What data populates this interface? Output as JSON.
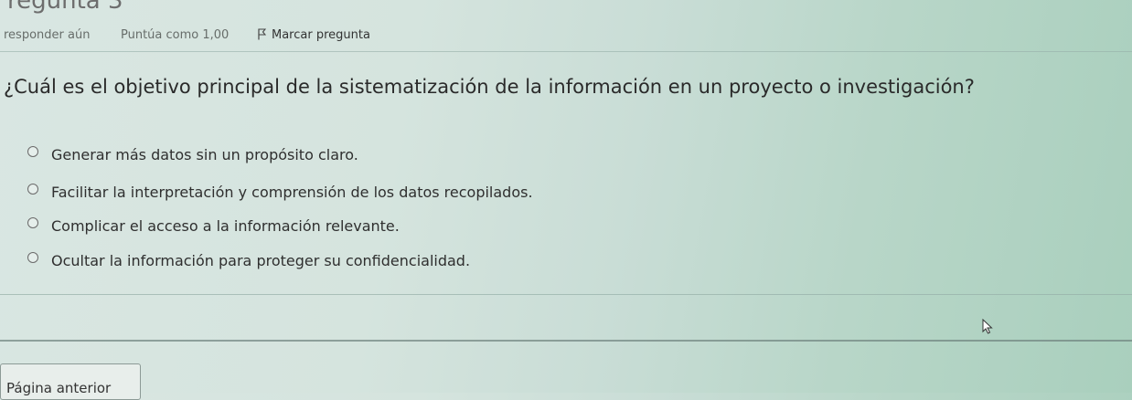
{
  "header": {
    "title_partial": "regunta 3",
    "status_text": "responder aún",
    "score_text": "Puntúa como 1,00",
    "flag_label": "Marcar pregunta"
  },
  "question": {
    "text": "¿Cuál es el objetivo principal de la sistematización de la información en un proyecto o investigación?",
    "options": [
      {
        "label": "Generar más datos sin un propósito claro."
      },
      {
        "label": "Facilitar la interpretación y comprensión de los datos recopilados."
      },
      {
        "label": "Complicar el acceso a la información relevante."
      },
      {
        "label": "Ocultar la información para proteger su confidencialidad."
      }
    ]
  },
  "navigation": {
    "prev_label": "Página anterior"
  },
  "icons": {
    "flag": "flag-icon",
    "cursor": "mouse-cursor-icon"
  }
}
